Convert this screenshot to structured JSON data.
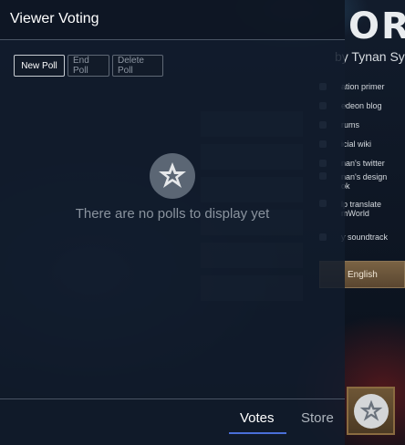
{
  "game": {
    "logo_text": "OR",
    "byline": "by Tynan Sy",
    "links": [
      {
        "label": "ation primer",
        "tall": false
      },
      {
        "label": "edeon blog",
        "tall": false
      },
      {
        "label": "rums",
        "tall": false
      },
      {
        "label": "icial wiki",
        "tall": false
      },
      {
        "label": "nan's twitter",
        "tall": false
      },
      {
        "label": "nan's design\nok",
        "tall": true
      },
      {
        "label": "lp translate\nmWorld",
        "tall": true
      },
      {
        "label": "y soundtrack",
        "tall": false
      }
    ],
    "language_button": "English"
  },
  "panel": {
    "title": "Viewer Voting",
    "toolbar": {
      "new_poll": "New Poll",
      "end_poll": "End Poll",
      "delete_poll": "Delete Poll"
    },
    "empty_message": "There are no polls to display yet",
    "tabs": {
      "votes": "Votes",
      "store": "Store"
    },
    "active_tab": "Votes",
    "accent_color": "#4a6fd8"
  },
  "icons": {
    "empty_state": "streamer-star-logo-icon",
    "corner": "streamer-star-logo-icon"
  }
}
